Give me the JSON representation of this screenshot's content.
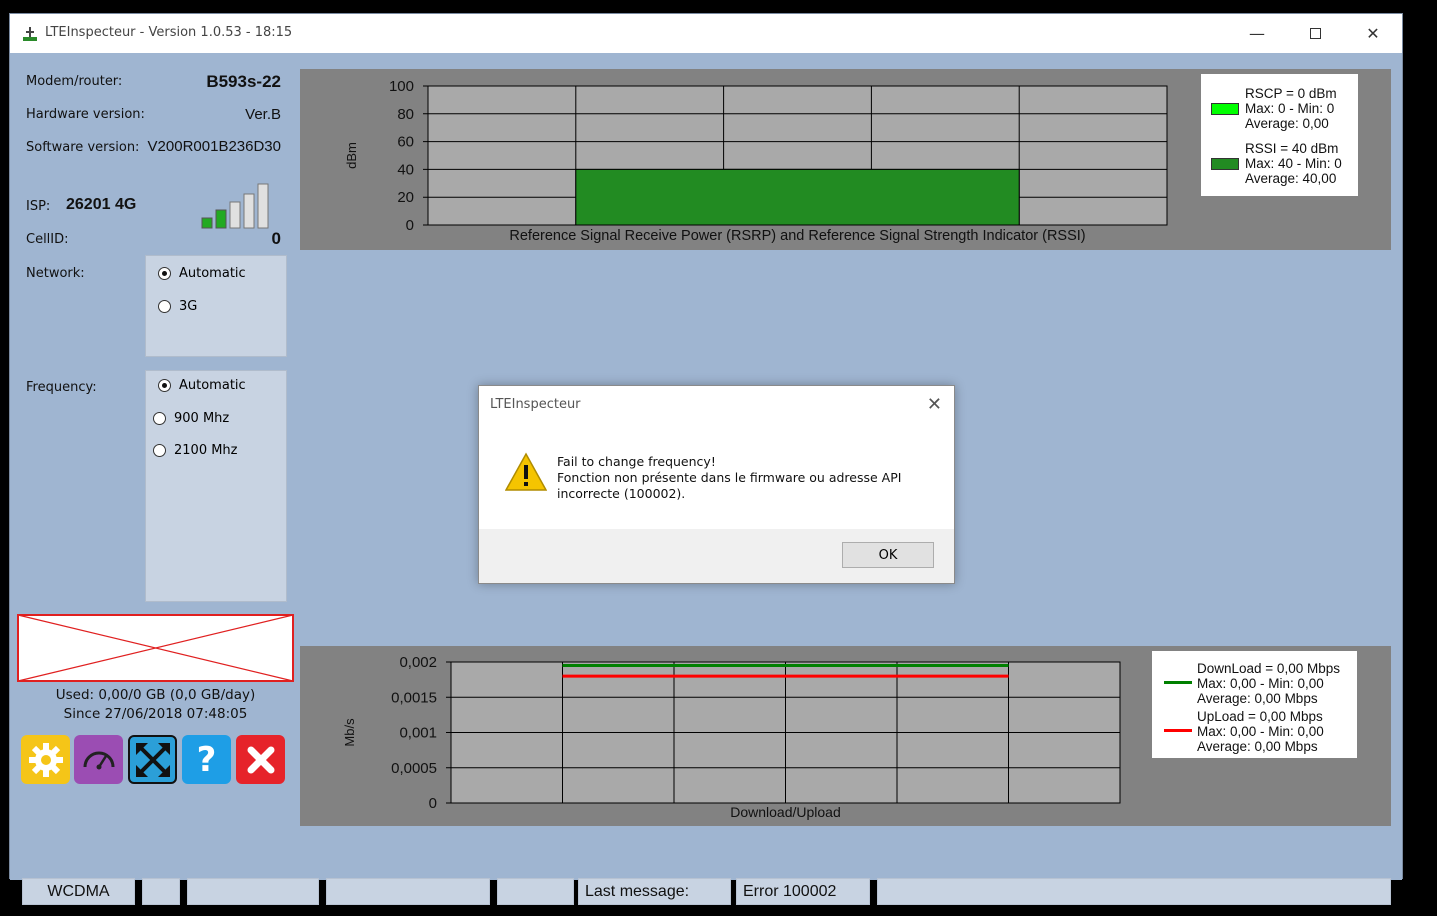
{
  "window": {
    "title": "LTEInspecteur - Version 1.0.53 - 18:15",
    "minimize_icon": "minimize-icon",
    "maximize_icon": "maximize-icon",
    "close_icon": "close-icon"
  },
  "info": {
    "modem_label": "Modem/router:",
    "modem_value": "B593s-22",
    "hardware_label": "Hardware version:",
    "hardware_value": "Ver.B",
    "software_label": "Software version:",
    "software_value": "V200R001B236D30",
    "isp_label": "ISP:",
    "isp_value": "26201 4G",
    "cellid_label": "CellID:",
    "cellid_value": "0",
    "signal_bars_lit": 2,
    "signal_bars_total": 5
  },
  "network": {
    "label": "Network:",
    "options": [
      {
        "label": "Automatic",
        "selected": true
      },
      {
        "label": "3G",
        "selected": false
      }
    ]
  },
  "frequency": {
    "label": "Frequency:",
    "options": [
      {
        "label": "Automatic",
        "selected": true
      },
      {
        "label": "900 Mhz",
        "selected": false
      },
      {
        "label": "2100 Mhz",
        "selected": false
      }
    ]
  },
  "usage": {
    "used": "Used: 0,00/0 GB (0,0 GB/day)",
    "since": "Since 27/06/2018 07:48:05"
  },
  "toolbar": {
    "buttons": [
      {
        "icon": "gear-icon",
        "color": "#f5c518"
      },
      {
        "icon": "speedometer-icon",
        "color": "#9b4db3"
      },
      {
        "icon": "expand-arrows-icon",
        "color": "#2b9fd8"
      },
      {
        "icon": "help-icon",
        "color": "#1e9ee6"
      },
      {
        "icon": "close-icon",
        "color": "#e6232a"
      }
    ]
  },
  "signal_chart": {
    "chart_data": {
      "type": "bar",
      "title": "Reference Signal Receive Power (RSRP) and Reference Signal Strength Indicator (RSSI)",
      "ylabel": "dBm",
      "ylim": [
        0,
        100
      ],
      "yticks": [
        "100",
        "80",
        "60",
        "40",
        "20",
        "0"
      ],
      "series": [
        {
          "name": "RSCP",
          "value": 0,
          "color": "#00ff00"
        },
        {
          "name": "RSSI",
          "value": 40,
          "color": "#228b22"
        }
      ],
      "grid": true
    },
    "legend": [
      {
        "line1": "RSCP = 0 dBm",
        "line2": "Max: 0 - Min: 0",
        "line3": "Average: 0,00",
        "color": "#00ff00"
      },
      {
        "line1": "RSSI = 40 dBm",
        "line2": "Max: 40 - Min: 0",
        "line3": "Average: 40,00",
        "color": "#228b22"
      }
    ]
  },
  "speed_chart": {
    "chart_data": {
      "type": "line",
      "xlabel": "Download/Upload",
      "ylabel": "Mb/s",
      "ylim": [
        0,
        0.002
      ],
      "yticks": [
        "0,002",
        "0,0015",
        "0,001",
        "0,0005",
        "0"
      ],
      "series": [
        {
          "name": "DownLoad",
          "value": 0.00195,
          "color": "#008000"
        },
        {
          "name": "UpLoad",
          "value": 0.0018,
          "color": "#ff0000"
        }
      ],
      "grid": true
    },
    "legend": [
      {
        "line1": "DownLoad = 0,00 Mbps",
        "line2": "Max: 0,00 - Min: 0,00",
        "line3": "Average: 0,00 Mbps",
        "color": "#008000"
      },
      {
        "line1": "UpLoad = 0,00 Mbps",
        "line2": "Max: 0,00 - Min: 0,00",
        "line3": "Average: 0,00 Mbps",
        "color": "#ff0000"
      }
    ]
  },
  "dialog": {
    "title": "LTEInspecteur",
    "icon": "warning-icon",
    "line1": "Fail to change frequency!",
    "line2": "Fonction non présente dans le firmware ou adresse API",
    "line3": "incorrecte (100002).",
    "ok_label": "OK"
  },
  "statusbar": {
    "network_type": "WCDMA",
    "last_message_label": "Last message:",
    "last_message_value": "Error 100002"
  }
}
